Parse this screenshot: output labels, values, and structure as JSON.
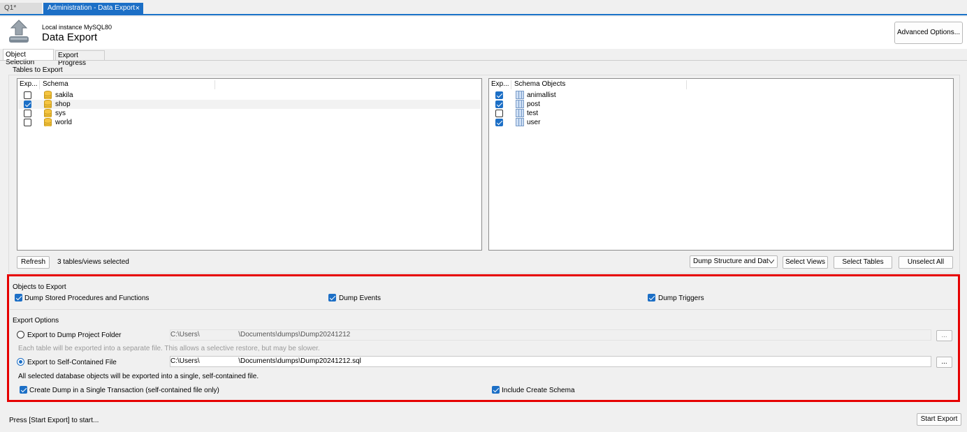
{
  "tabs": {
    "q1": "Q1*",
    "admin": "Administration - Data Export",
    "close": "×"
  },
  "header": {
    "instance": "Local instance MySQL80",
    "title": "Data Export",
    "advanced_btn": "Advanced Options..."
  },
  "subtabs": {
    "object_selection": "Object Selection",
    "export_progress": "Export Progress"
  },
  "tables_to_export": {
    "label": "Tables to Export",
    "schema_header": {
      "exp": "Exp...",
      "name": "Schema"
    },
    "schemas": [
      {
        "name": "sakila",
        "checked": false
      },
      {
        "name": "shop",
        "checked": true
      },
      {
        "name": "sys",
        "checked": false
      },
      {
        "name": "world",
        "checked": false
      }
    ],
    "objects_header": {
      "exp": "Exp...",
      "name": "Schema Objects"
    },
    "objects": [
      {
        "name": "animallist",
        "checked": true
      },
      {
        "name": "post",
        "checked": true
      },
      {
        "name": "test",
        "checked": false
      },
      {
        "name": "user",
        "checked": true
      }
    ],
    "refresh_btn": "Refresh",
    "selected_count": "3 tables/views selected",
    "dump_select": "Dump Structure and Dat",
    "select_views_btn": "Select Views",
    "select_tables_btn": "Select Tables",
    "unselect_all_btn": "Unselect All"
  },
  "objects_to_export": {
    "label": "Objects to Export",
    "routines": "Dump Stored Procedures and Functions",
    "events": "Dump Events",
    "triggers": "Dump Triggers"
  },
  "export_options": {
    "label": "Export Options",
    "folder_radio": "Export to Dump Project Folder",
    "folder_path": "C:\\Users\\                    \\Documents\\dumps\\Dump20241212",
    "folder_hint": "Each table will be exported into a separate file. This allows a selective restore, but may be slower.",
    "file_radio": "Export to Self-Contained File",
    "file_path": "C:\\Users\\                    \\Documents\\dumps\\Dump20241212.sql",
    "file_hint": "All selected database objects will be exported into a single, self-contained file.",
    "browse": "...",
    "single_transaction": "Create Dump in a Single Transaction (self-contained file only)",
    "include_schema": "Include Create Schema"
  },
  "footer": {
    "status": "Press [Start Export] to start...",
    "start_btn": "Start Export"
  },
  "colors": {
    "accent": "#1c6fc6",
    "highlight": "#e60000"
  }
}
